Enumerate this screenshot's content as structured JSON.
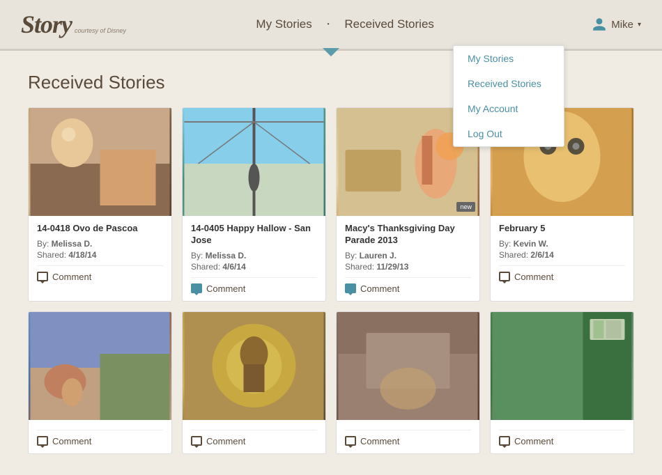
{
  "header": {
    "logo_text": "Story",
    "logo_courtesy": "courtesy of Disney",
    "nav": {
      "my_stories": "My Stories",
      "dot": "·",
      "received_stories": "Received Stories"
    },
    "user": {
      "name": "Mike",
      "chevron": "▾"
    }
  },
  "dropdown": {
    "items": [
      {
        "label": "My Stories",
        "id": "my-stories"
      },
      {
        "label": "Received Stories",
        "id": "received-stories"
      },
      {
        "label": "My Account",
        "id": "my-account"
      },
      {
        "label": "Log Out",
        "id": "log-out"
      }
    ]
  },
  "main": {
    "page_title": "Received Stories",
    "stories": [
      {
        "id": 1,
        "title": "14-0418 Ovo de Pascoa",
        "author": "Melissa D.",
        "shared": "4/18/14",
        "comment_label": "Comment",
        "has_new": false,
        "img_class": "img-1"
      },
      {
        "id": 2,
        "title": "14-0405 Happy Hallow - San Jose",
        "author": "Melissa D.",
        "shared": "4/6/14",
        "comment_label": "Comment",
        "has_new": true,
        "img_class": "img-2"
      },
      {
        "id": 3,
        "title": "Macy's Thanksgiving Day Parade 2013",
        "author": "Lauren J.",
        "shared": "11/29/13",
        "comment_label": "Comment",
        "has_new": true,
        "img_class": "img-3"
      },
      {
        "id": 4,
        "title": "February 5",
        "author": "Kevin W.",
        "shared": "2/6/14",
        "comment_label": "Comment",
        "has_new": false,
        "img_class": "img-4"
      },
      {
        "id": 5,
        "title": "",
        "author": "",
        "shared": "",
        "comment_label": "Comment",
        "has_new": false,
        "img_class": "img-5"
      },
      {
        "id": 6,
        "title": "",
        "author": "",
        "shared": "",
        "comment_label": "Comment",
        "has_new": false,
        "img_class": "img-6"
      },
      {
        "id": 7,
        "title": "",
        "author": "",
        "shared": "",
        "comment_label": "Comment",
        "has_new": false,
        "img_class": "img-7"
      },
      {
        "id": 8,
        "title": "",
        "author": "",
        "shared": "",
        "comment_label": "Comment",
        "has_new": false,
        "img_class": "img-8"
      }
    ],
    "by_label": "By:",
    "shared_label": "Shared:",
    "new_badge": "new"
  }
}
